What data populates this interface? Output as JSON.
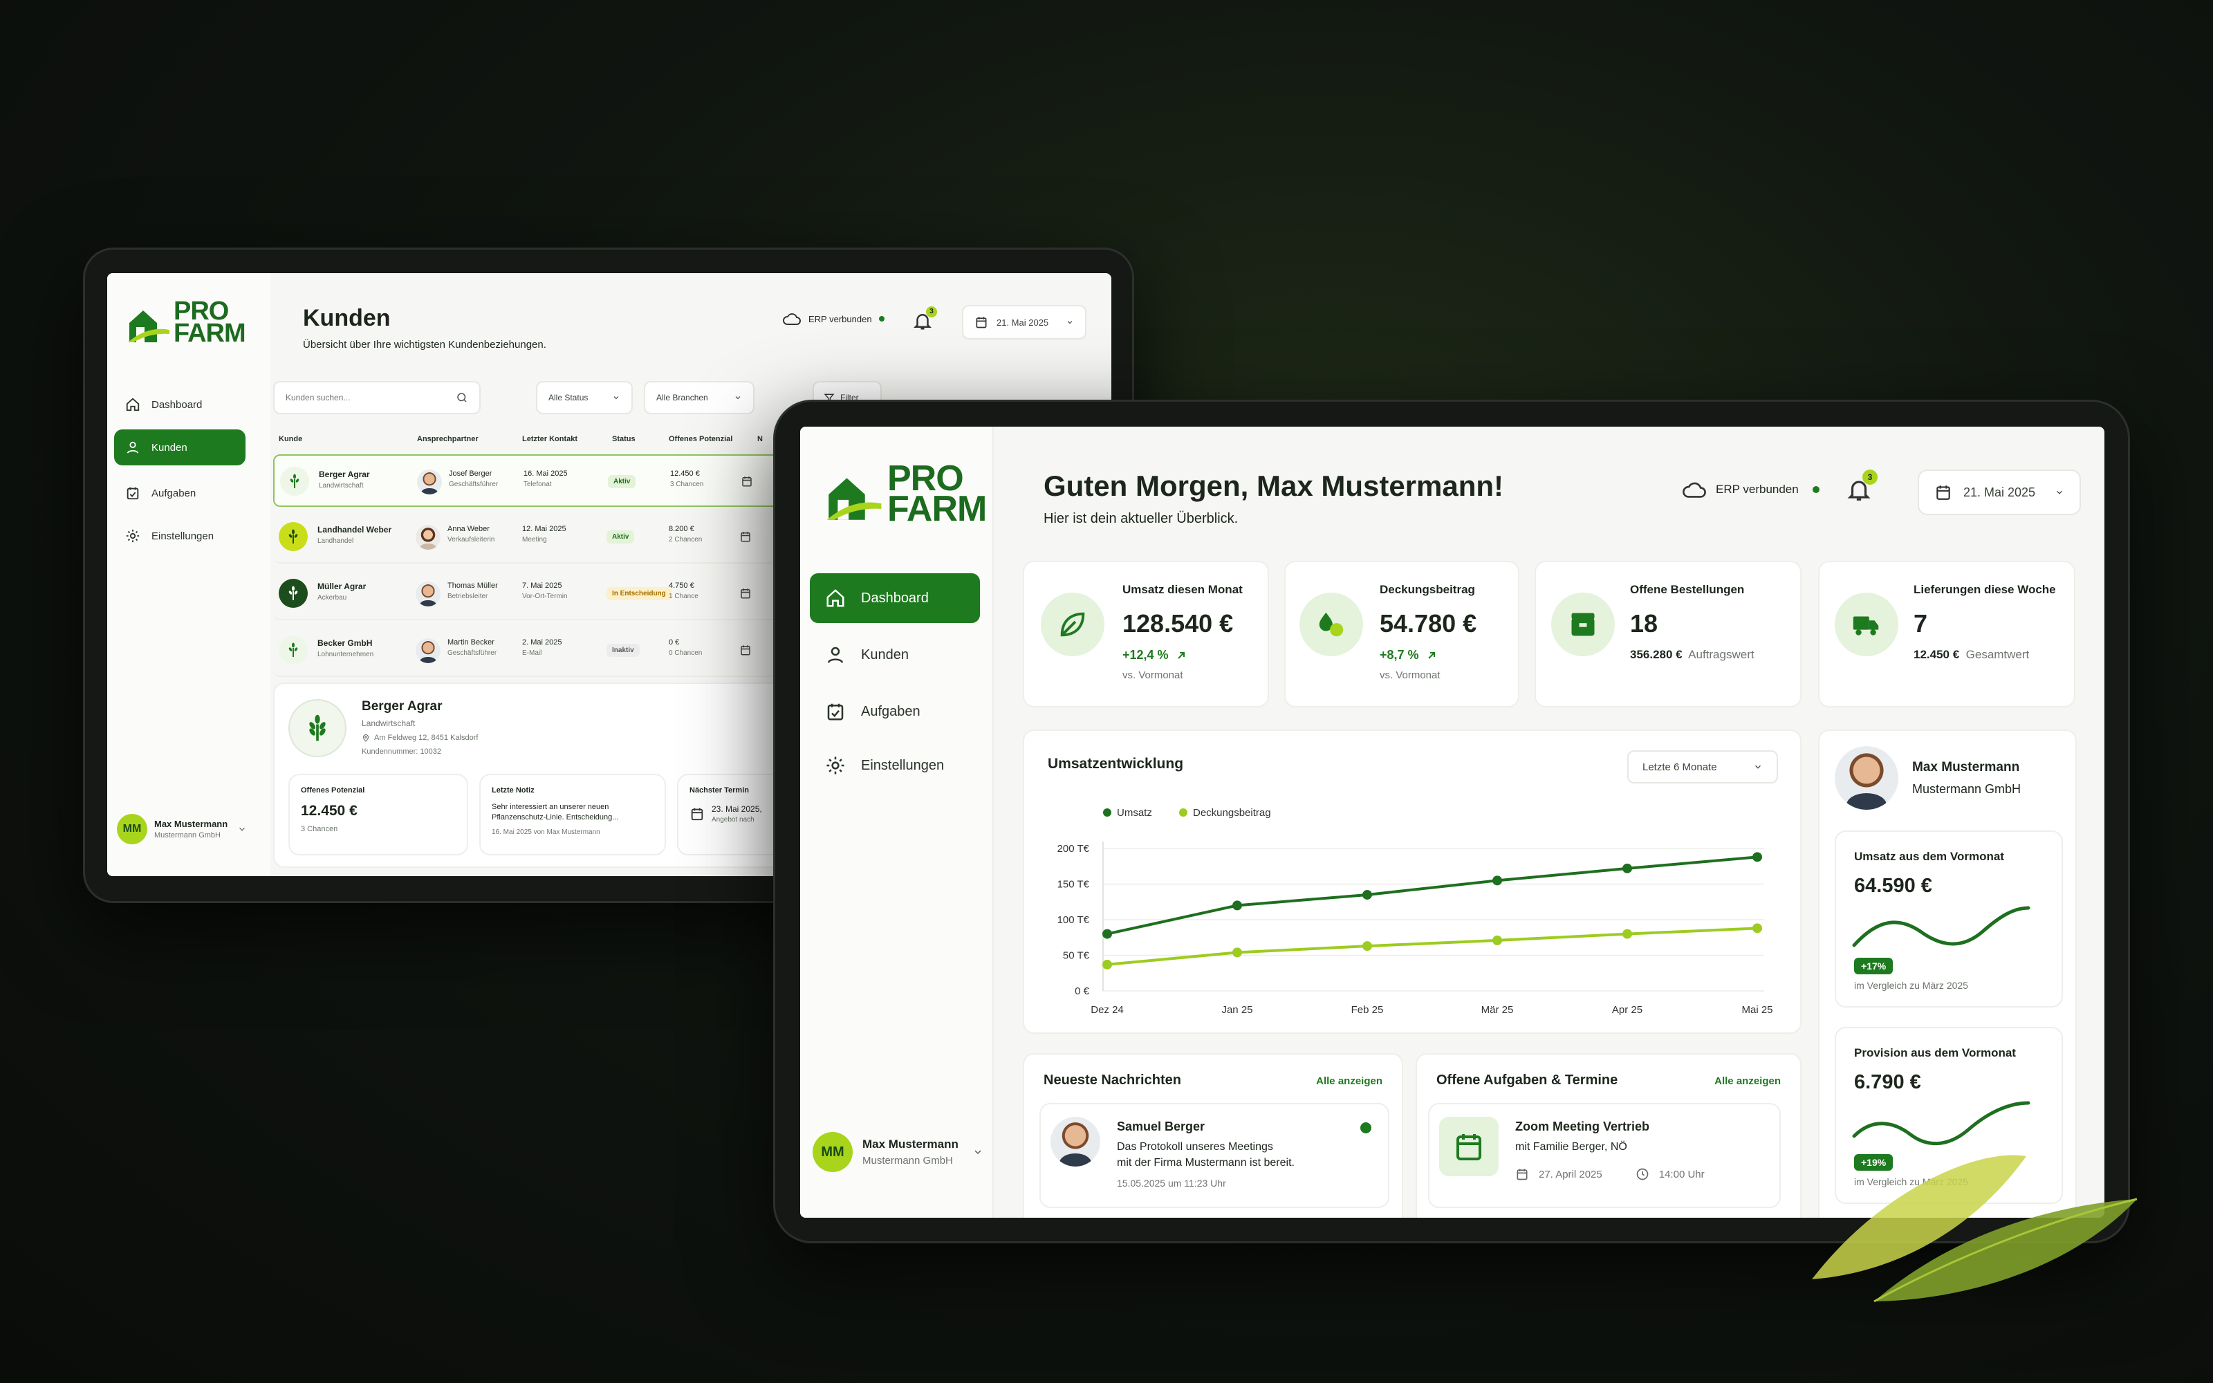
{
  "brand": {
    "line1": "PRO",
    "line2": "FARM",
    "primary": "#1e7a1f",
    "accent": "#a8d41c"
  },
  "nav": [
    {
      "id": "dashboard",
      "label": "Dashboard",
      "icon": "home-icon"
    },
    {
      "id": "kunden",
      "label": "Kunden",
      "icon": "user-icon"
    },
    {
      "id": "aufgaben",
      "label": "Aufgaben",
      "icon": "calendar-check-icon"
    },
    {
      "id": "einstellungen",
      "label": "Einstellungen",
      "icon": "gear-icon"
    }
  ],
  "user": {
    "initials": "MM",
    "name": "Max Mustermann",
    "company": "Mustermann GmbH"
  },
  "topbar": {
    "erp": "ERP verbunden",
    "notifications": "3",
    "date": "21. Mai 2025"
  },
  "kunden": {
    "title": "Kunden",
    "subtitle": "Übersicht über Ihre wichtigsten Kundenbeziehungen.",
    "search_placeholder": "Kunden suchen...",
    "filter_status": "Alle Status",
    "filter_branchen": "Alle Branchen",
    "filter_label": "Filter",
    "columns": [
      "Kunde",
      "Ansprechpartner",
      "Letzter Kontakt",
      "Status",
      "Offenes Potenzial",
      "N"
    ],
    "rows": [
      {
        "name": "Berger Agrar",
        "type": "Landwirtschaft",
        "contact": "Josef Berger",
        "role": "Geschäftsführer",
        "date": "16. Mai 2025",
        "channel": "Telefonat",
        "status": "Aktiv",
        "amount": "12.450 €",
        "chances": "3 Chancen"
      },
      {
        "name": "Landhandel Weber",
        "type": "Landhandel",
        "contact": "Anna Weber",
        "role": "Verkaufsleiterin",
        "date": "12. Mai 2025",
        "channel": "Meeting",
        "status": "Aktiv",
        "amount": "8.200 €",
        "chances": "2 Chancen"
      },
      {
        "name": "Müller Agrar",
        "type": "Ackerbau",
        "contact": "Thomas Müller",
        "role": "Betriebsleiter",
        "date": "7. Mai 2025",
        "channel": "Vor-Ort-Termin",
        "status": "In Entscheidung",
        "amount": "4.750 €",
        "chances": "1 Chance"
      },
      {
        "name": "Becker GmbH",
        "type": "Lohnunternehmen",
        "contact": "Martin Becker",
        "role": "Geschäftsführer",
        "date": "2. Mai 2025",
        "channel": "E-Mail",
        "status": "Inaktiv",
        "amount": "0 €",
        "chances": "0 Chancen"
      }
    ],
    "detail": {
      "name": "Berger Agrar",
      "type": "Landwirtschaft",
      "address": "Am Feldweg 12, 8451 Kalsdorf",
      "number": "Kundennummer: 10032",
      "potential_label": "Offenes Potenzial",
      "potential_value": "12.450 €",
      "potential_sub": "3 Chancen",
      "note_label": "Letzte Notiz",
      "note_text1": "Sehr interessiert an unserer neuen",
      "note_text2": "Pflanzenschutz-Linie. Entscheidung...",
      "note_meta": "16. Mai 2025 von Max Mustermann",
      "next_label": "Nächster Termin",
      "next_date": "23. Mai 2025,",
      "next_sub": "Angebot nach"
    }
  },
  "dashboard": {
    "greeting": "Guten Morgen, Max Mustermann!",
    "subtitle": "Hier ist dein aktueller Überblick.",
    "kpis": [
      {
        "label": "Umsatz diesen Monat",
        "value": "128.540 €",
        "delta": "+12,4 %",
        "sub": "vs. Vormonat",
        "icon": "leaf-icon"
      },
      {
        "label": "Deckungsbeitrag",
        "value": "54.780 €",
        "delta": "+8,7 %",
        "sub": "vs. Vormonat",
        "icon": "drops-icon"
      },
      {
        "label": "Offene Bestellungen",
        "value": "18",
        "strong": "356.280 €",
        "sub": "Auftragswert",
        "icon": "box-icon"
      },
      {
        "label": "Lieferungen diese Woche",
        "value": "7",
        "strong": "12.450 €",
        "sub": "Gesamtwert",
        "icon": "truck-icon"
      }
    ],
    "chart_title": "Umsatzentwicklung",
    "chart_range": "Letzte 6 Monate",
    "messages": {
      "title": "Neueste Nachrichten",
      "link": "Alle anzeigen",
      "sender": "Samuel Berger",
      "line1": "Das Protokoll unseres Meetings",
      "line2": "mit der Firma Mustermann ist bereit.",
      "time": "15.05.2025 um 11:23 Uhr"
    },
    "tasks": {
      "title": "Offene Aufgaben & Termine",
      "link": "Alle anzeigen",
      "name": "Zoom Meeting Vertrieb",
      "sub": "mit Familie Berger, NÖ",
      "date": "27. April 2025",
      "time": "14:00 Uhr"
    },
    "profile": {
      "name": "Max Mustermann",
      "company": "Mustermann GmbH"
    },
    "mini": [
      {
        "label": "Umsatz aus dem Vormonat",
        "value": "64.590 €",
        "badge": "+17%",
        "sub": "im Vergleich zu März 2025"
      },
      {
        "label": "Provision aus dem Vormonat",
        "value": "6.790 €",
        "badge": "+19%",
        "sub": "im Vergleich zu März 2025"
      }
    ]
  },
  "chart_data": {
    "type": "line",
    "title": "Umsatzentwicklung",
    "categories": [
      "Dez 24",
      "Jan 25",
      "Feb 25",
      "Mär 25",
      "Apr 25",
      "Mai 25"
    ],
    "series": [
      {
        "name": "Umsatz",
        "values": [
          80,
          120,
          135,
          155,
          172,
          188
        ],
        "color": "#1e6f1f"
      },
      {
        "name": "Deckungsbeitrag",
        "values": [
          37,
          54,
          63,
          71,
          80,
          88
        ],
        "color": "#9ccc1f"
      }
    ],
    "yticks": [
      "0 €",
      "50 T€",
      "100 T€",
      "150 T€",
      "200 T€"
    ],
    "ylim": [
      0,
      200
    ],
    "grid": true,
    "legend": "top-left"
  }
}
